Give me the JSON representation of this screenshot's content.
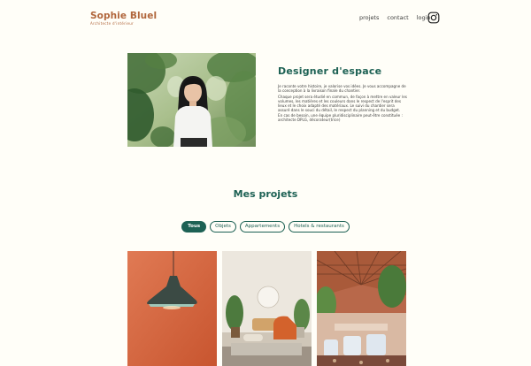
{
  "header": {
    "logo_name": "Sophie Bluel",
    "logo_subtitle": "Architecte d'intérieur",
    "nav": [
      "projets",
      "contact",
      "login"
    ],
    "social_icon": "instagram-icon"
  },
  "intro": {
    "photo_alt": "Sophie Bluel",
    "title": "Designer d'espace",
    "paragraphs": [
      "Je raconte votre histoire, je valorise vos idées. Je vous accompagne de la conception à la livraison finale du chantier.",
      "Chaque projet sera étudié en commun, de façon à mettre en valeur les volumes, les matières et les couleurs dans le respect de l'esprit des lieux et le choix adapté des matériaux. Le suivi du chantier sera assuré dans le souci du détail, le respect du planning et du budget.",
      "En cas de besoin, une équipe pluridisciplinaire peut-être constituée : architecte DPLG, décorateur(trice)"
    ]
  },
  "projects": {
    "title": "Mes projets",
    "filters": [
      "Tous",
      "Objets",
      "Appartements",
      "Hotels & restaurants"
    ],
    "active_filter": "Tous"
  },
  "colors": {
    "accent": "#1d6154",
    "brand": "#b1663c",
    "background": "#fffef8"
  }
}
